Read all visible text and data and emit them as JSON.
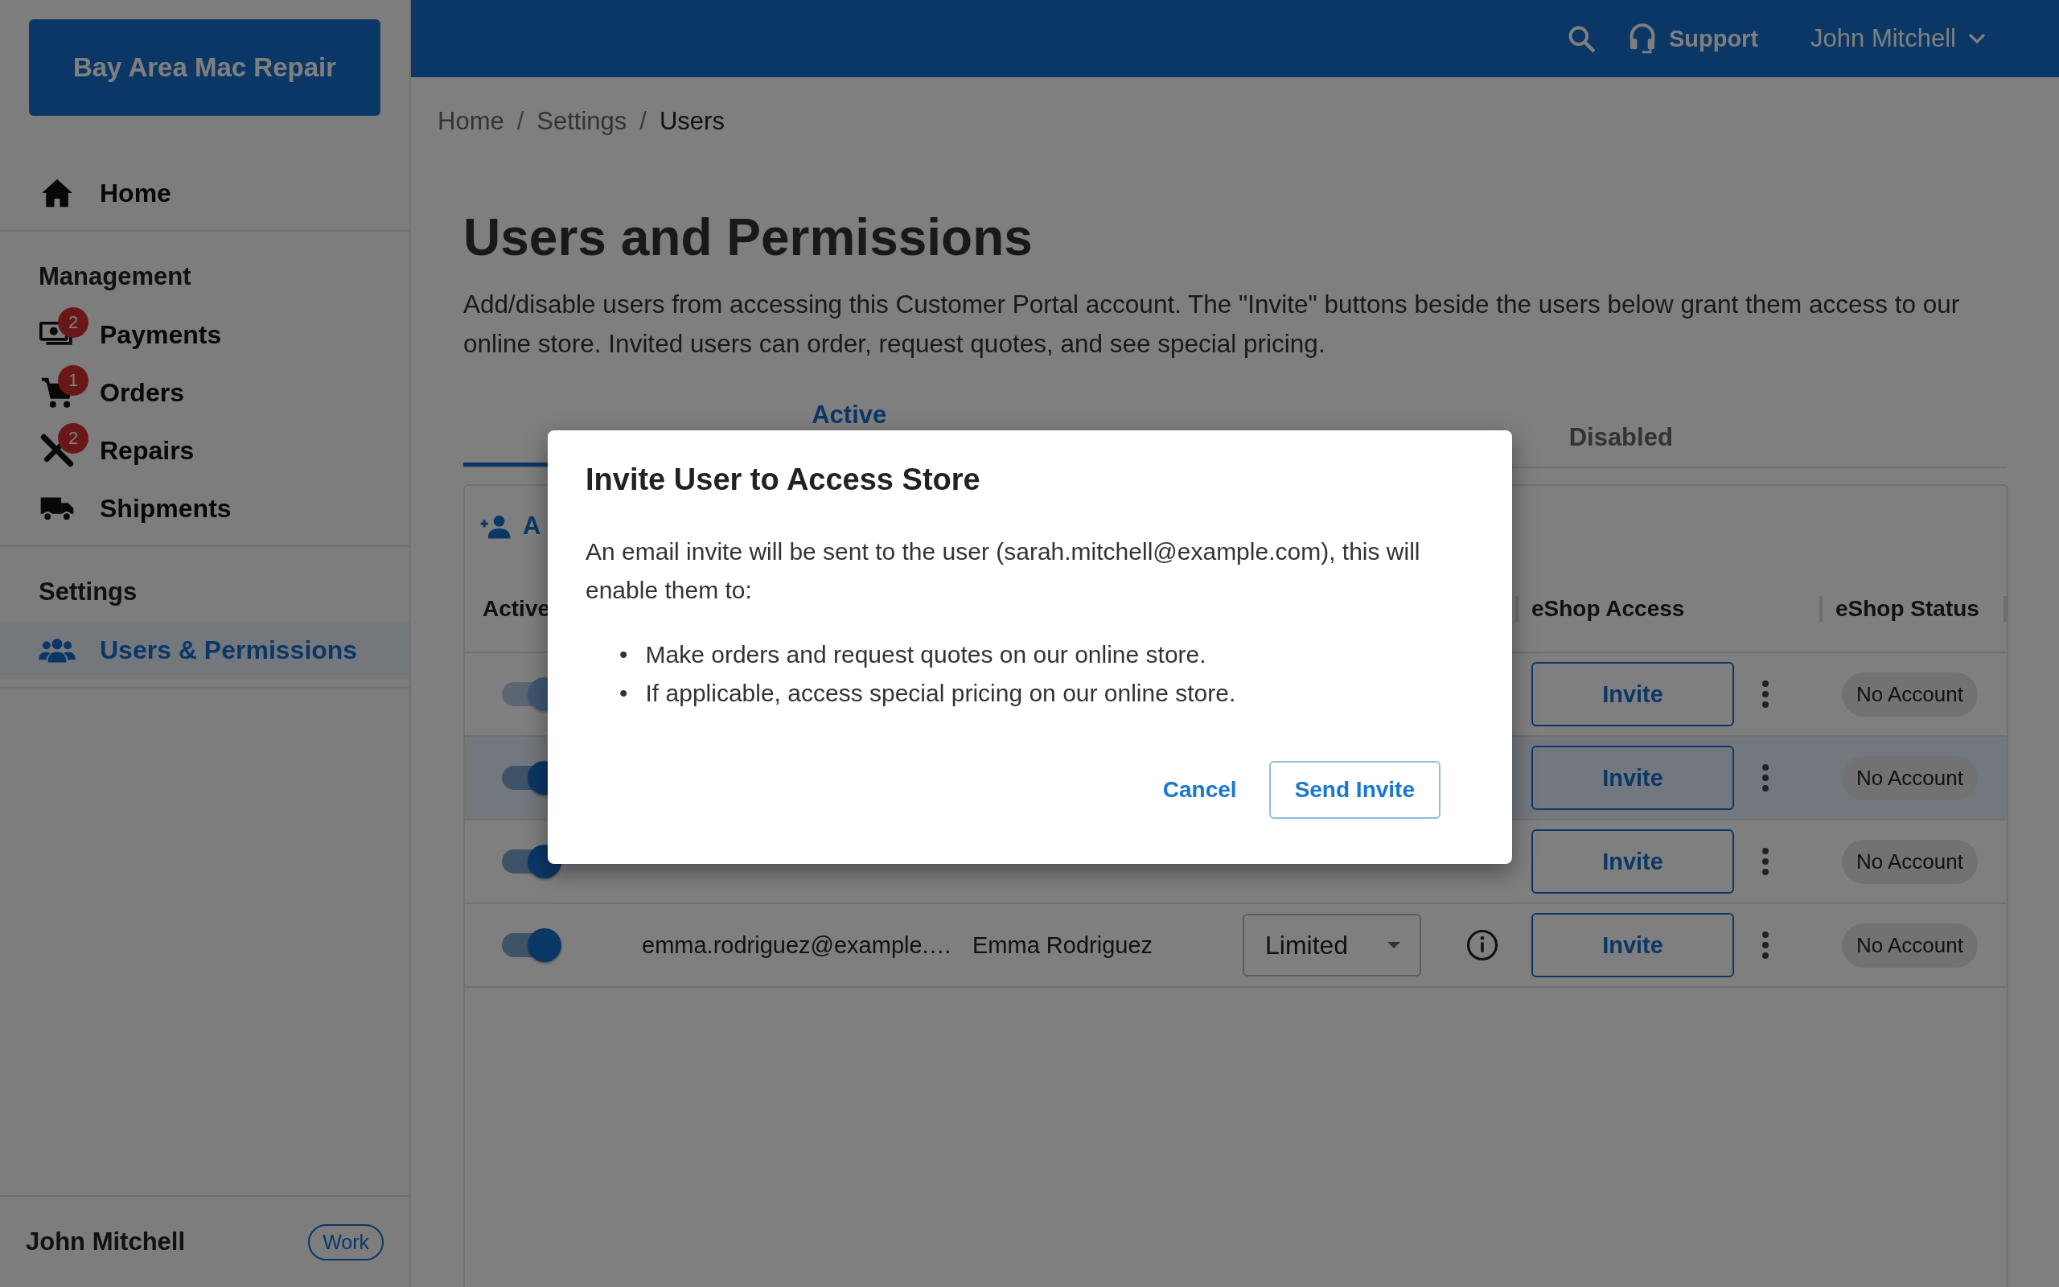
{
  "topbar": {
    "support": "Support",
    "user": "John Mitchell"
  },
  "sidebar": {
    "logo": "Bay Area Mac Repair",
    "sections": [
      {
        "items": [
          {
            "label": "Home",
            "kind": "home",
            "selected": false
          }
        ]
      },
      {
        "title": "Management",
        "items": [
          {
            "label": "Payments",
            "kind": "payments",
            "badge": "2",
            "selected": false
          },
          {
            "label": "Orders",
            "kind": "cart",
            "badge": "1",
            "selected": false
          },
          {
            "label": "Repairs",
            "kind": "tools",
            "badge": "2",
            "selected": false
          },
          {
            "label": "Shipments",
            "kind": "truck",
            "selected": false
          }
        ]
      },
      {
        "title": "Settings",
        "items": [
          {
            "label": "Users & Permissions",
            "kind": "users",
            "selected": true
          }
        ]
      }
    ],
    "footer": {
      "user": "John Mitchell",
      "tag": "Work"
    }
  },
  "breadcrumb": {
    "separator": "/",
    "items": [
      {
        "label": "Home",
        "current": false
      },
      {
        "label": "Settings",
        "current": false
      },
      {
        "label": "Users",
        "current": true
      }
    ]
  },
  "page": {
    "title": "Users and Permissions",
    "description": "Add/disable users from accessing this Customer Portal account. The \"Invite\" buttons beside the users below grant them access to our online store. Invited users can order, request quotes, and see special pricing."
  },
  "tabs": [
    {
      "label": "Active",
      "selected": true
    },
    {
      "label": "Disabled",
      "selected": false
    }
  ],
  "table": {
    "add_button": "A",
    "columns": {
      "active": "Active",
      "eshop_access": "eShop Access",
      "eshop_status": "eShop Status"
    },
    "rows": [
      {
        "on": true,
        "disabled": true,
        "selected": false,
        "eshop_access": "Invite",
        "eshop_status": "No Account"
      },
      {
        "on": true,
        "disabled": false,
        "selected": true,
        "eshop_access": "Invite",
        "eshop_status": "No Account"
      },
      {
        "on": true,
        "disabled": false,
        "selected": false,
        "eshop_access": "Invite",
        "eshop_status": "No Account"
      },
      {
        "on": true,
        "disabled": false,
        "selected": false,
        "email": "emma.rodriguez@example.…",
        "name": "Emma Rodriguez",
        "role": "Limited",
        "eshop_access": "Invite",
        "eshop_status": "No Account"
      }
    ]
  },
  "dialog": {
    "title": "Invite User to Access Store",
    "body": "An email invite will be sent to the user (sarah.mitchell@example.com), this will enable them to:",
    "bullet": "•",
    "bullets": [
      "Make orders and request quotes on our online store.",
      "If applicable, access special pricing on our online store."
    ],
    "buttons": [
      {
        "label": "Cancel",
        "kind": "text"
      },
      {
        "label": "Send Invite",
        "kind": "outlined"
      }
    ]
  }
}
